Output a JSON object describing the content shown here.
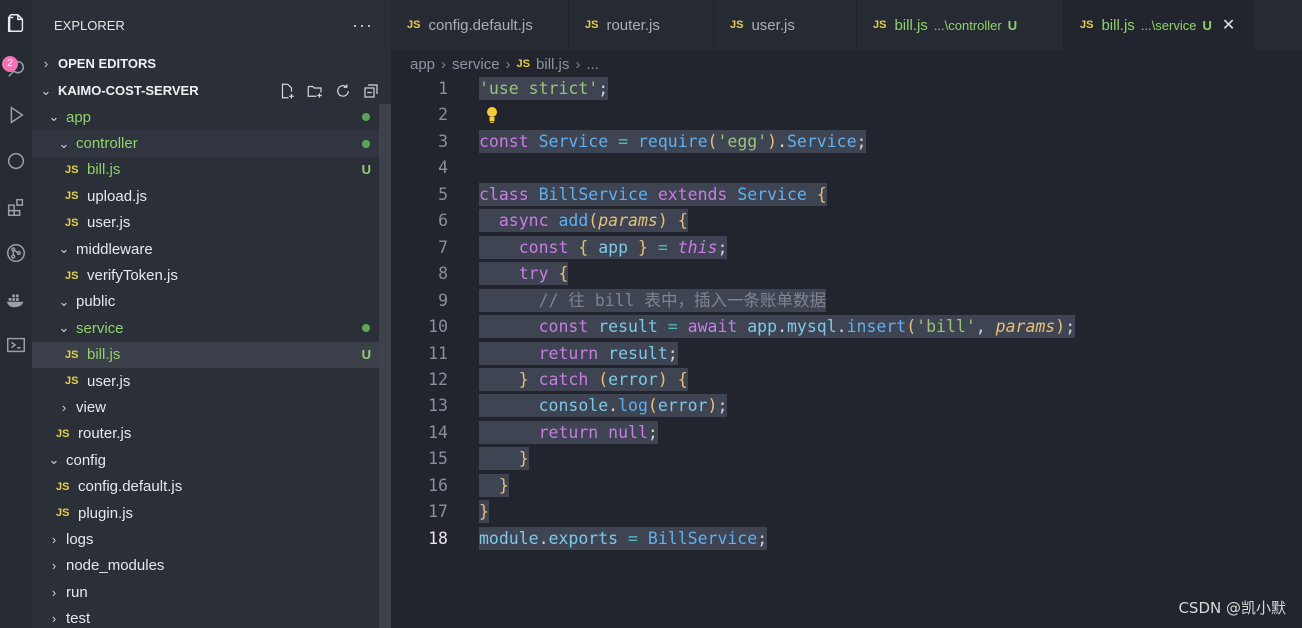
{
  "activity_bar": {
    "items": [
      "files-icon",
      "search-icon",
      "run-debug-icon",
      "remote-icon",
      "extensions-icon",
      "source-control-icon",
      "docker-icon",
      "terminal-icon"
    ],
    "badge": "2"
  },
  "sidebar": {
    "title": "EXPLORER",
    "more": "···",
    "open_editors": "OPEN EDITORS",
    "project": "KAIMO-COST-SERVER",
    "tree": [
      {
        "label": "app",
        "type": "folder",
        "open": true,
        "depth": 1,
        "status": "dot"
      },
      {
        "label": "controller",
        "type": "folder",
        "open": true,
        "depth": 2,
        "status": "dot"
      },
      {
        "label": "bill.js",
        "type": "js",
        "depth": 3,
        "status": "U"
      },
      {
        "label": "upload.js",
        "type": "js",
        "depth": 3
      },
      {
        "label": "user.js",
        "type": "js",
        "depth": 3
      },
      {
        "label": "middleware",
        "type": "folder",
        "open": true,
        "depth": 2
      },
      {
        "label": "verifyToken.js",
        "type": "js",
        "depth": 3
      },
      {
        "label": "public",
        "type": "folder",
        "open": true,
        "depth": 2
      },
      {
        "label": "service",
        "type": "folder",
        "open": true,
        "depth": 2,
        "status": "dot"
      },
      {
        "label": "bill.js",
        "type": "js",
        "depth": 3,
        "status": "U",
        "selected": true
      },
      {
        "label": "user.js",
        "type": "js",
        "depth": 3
      },
      {
        "label": "view",
        "type": "folder",
        "open": false,
        "depth": 2
      },
      {
        "label": "router.js",
        "type": "js",
        "depth": 2
      },
      {
        "label": "config",
        "type": "folder",
        "open": true,
        "depth": 1
      },
      {
        "label": "config.default.js",
        "type": "js",
        "depth": 2
      },
      {
        "label": "plugin.js",
        "type": "js",
        "depth": 2
      },
      {
        "label": "logs",
        "type": "folder",
        "open": false,
        "depth": 1
      },
      {
        "label": "node_modules",
        "type": "folder",
        "open": false,
        "depth": 1
      },
      {
        "label": "run",
        "type": "folder",
        "open": false,
        "depth": 1
      },
      {
        "label": "test",
        "type": "folder",
        "open": false,
        "depth": 1
      }
    ]
  },
  "tabs": [
    {
      "label": "config.default.js",
      "desc": "",
      "u": "",
      "green": false,
      "active": false,
      "width": 178
    },
    {
      "label": "router.js",
      "desc": "",
      "u": "",
      "green": false,
      "active": false,
      "width": 145
    },
    {
      "label": "user.js",
      "desc": "",
      "u": "",
      "green": false,
      "active": false,
      "width": 143
    },
    {
      "label": "bill.js",
      "desc": "...\\controller",
      "u": "U",
      "green": true,
      "active": false,
      "width": 207
    },
    {
      "label": "bill.js",
      "desc": "...\\service",
      "u": "U",
      "green": true,
      "active": true,
      "width": 190
    }
  ],
  "tab_close": "✕",
  "breadcrumb": {
    "parts": [
      "app",
      "service",
      "bill.js",
      "..."
    ],
    "sep": "›"
  },
  "editor": {
    "lines": [
      "'use strict';",
      "",
      "const Service = require('egg').Service;",
      "",
      "class BillService extends Service {",
      "  async add(params) {",
      "    const { app } = this;",
      "    try {",
      "      // 往 bill 表中，插入一条账单数据",
      "      const result = await app.mysql.insert('bill', params);",
      "      return result;",
      "    } catch (error) {",
      "      console.log(error);",
      "      return null;",
      "    }",
      "  }",
      "}",
      "module.exports = BillService;"
    ],
    "current_line": 18
  },
  "watermark": "CSDN @凯小默",
  "colors": {
    "accent_green": "#8fd36a",
    "js_yellow": "#e5d04a",
    "selection": "#3e4452"
  }
}
